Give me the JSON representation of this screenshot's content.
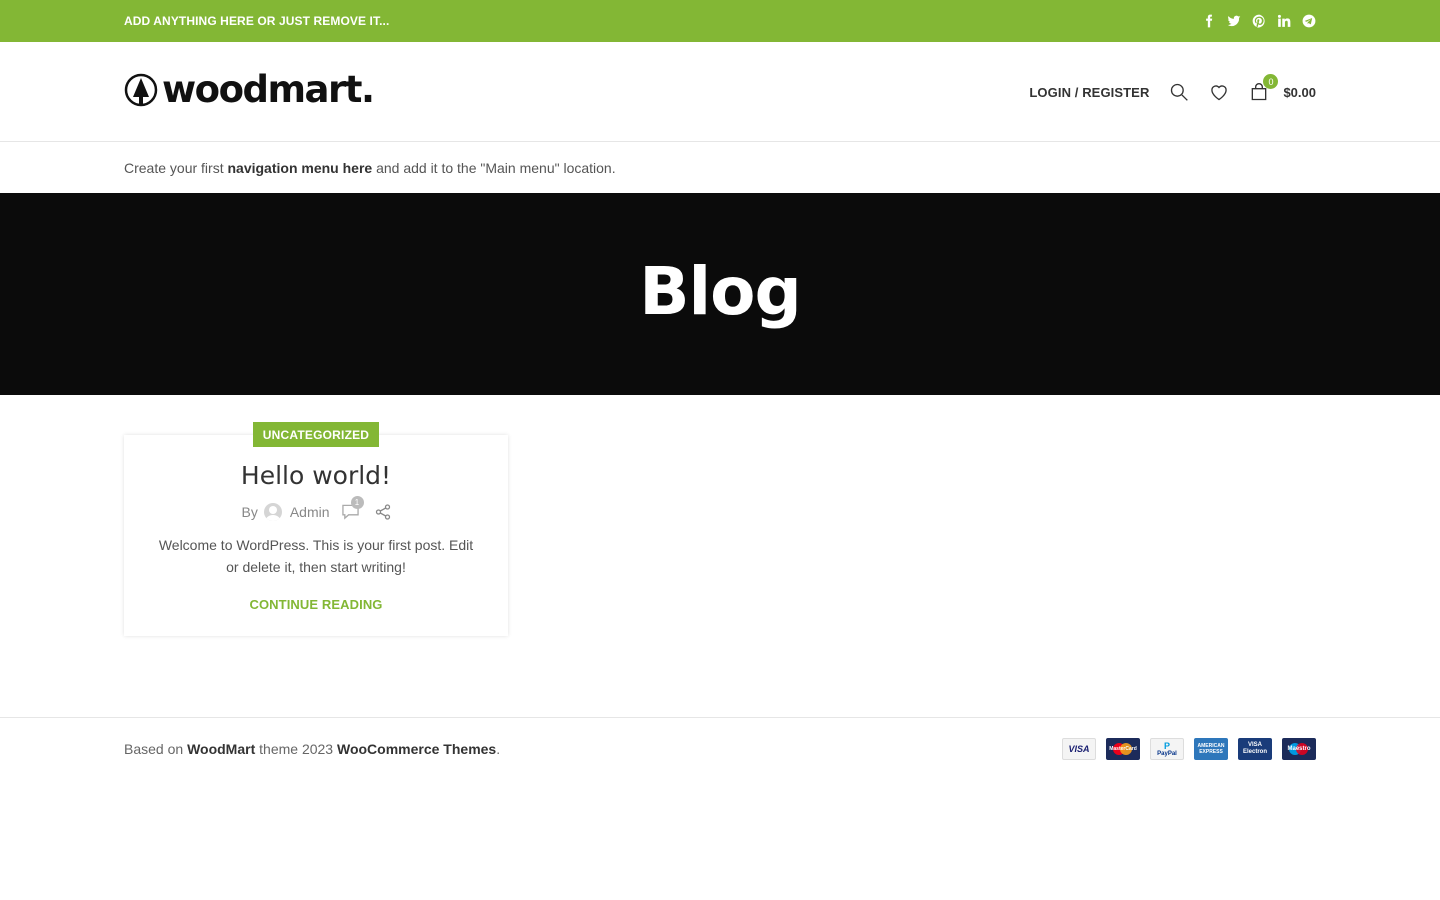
{
  "topbar": {
    "text": "ADD ANYTHING HERE OR JUST REMOVE IT...",
    "background": "#83b735",
    "social_icons": [
      "facebook-icon",
      "twitter-icon",
      "pinterest-icon",
      "linkedin-icon",
      "telegram-icon"
    ]
  },
  "header": {
    "logo_text": "woodmart.",
    "login_label": "LOGIN / REGISTER",
    "cart_count": "0",
    "cart_total": "$0.00",
    "icons": [
      "search-icon",
      "wishlist-heart-icon",
      "cart-bag-icon"
    ]
  },
  "nav": {
    "prefix": "Create your first",
    "link": "navigation menu here",
    "suffix": "and add it to the \"Main menu\" location."
  },
  "hero": {
    "title": "Blog",
    "background": "#0b0b0b"
  },
  "post": {
    "category": "UNCATEGORIZED",
    "title": "Hello world!",
    "by": "By",
    "author": "Admin",
    "comment_count": "1",
    "excerpt": "Welcome to WordPress. This is your first post. Edit or delete it, then start writing!",
    "continue_label": "CONTINUE READING"
  },
  "footer": {
    "based_on": "Based on",
    "theme_link": "WoodMart",
    "middle": "theme 2023",
    "company_link": "WooCommerce Themes",
    "end": ".",
    "payments": {
      "visa": "VISA",
      "mastercard": "MasterCard",
      "paypal_p": "P",
      "paypal": "PayPal",
      "amex": "AMERICAN EXPRESS",
      "electron_top": "VISA",
      "electron_bottom": "Electron",
      "maestro": "Maestro"
    }
  },
  "colors": {
    "accent": "#83b735",
    "text": "#333333"
  }
}
